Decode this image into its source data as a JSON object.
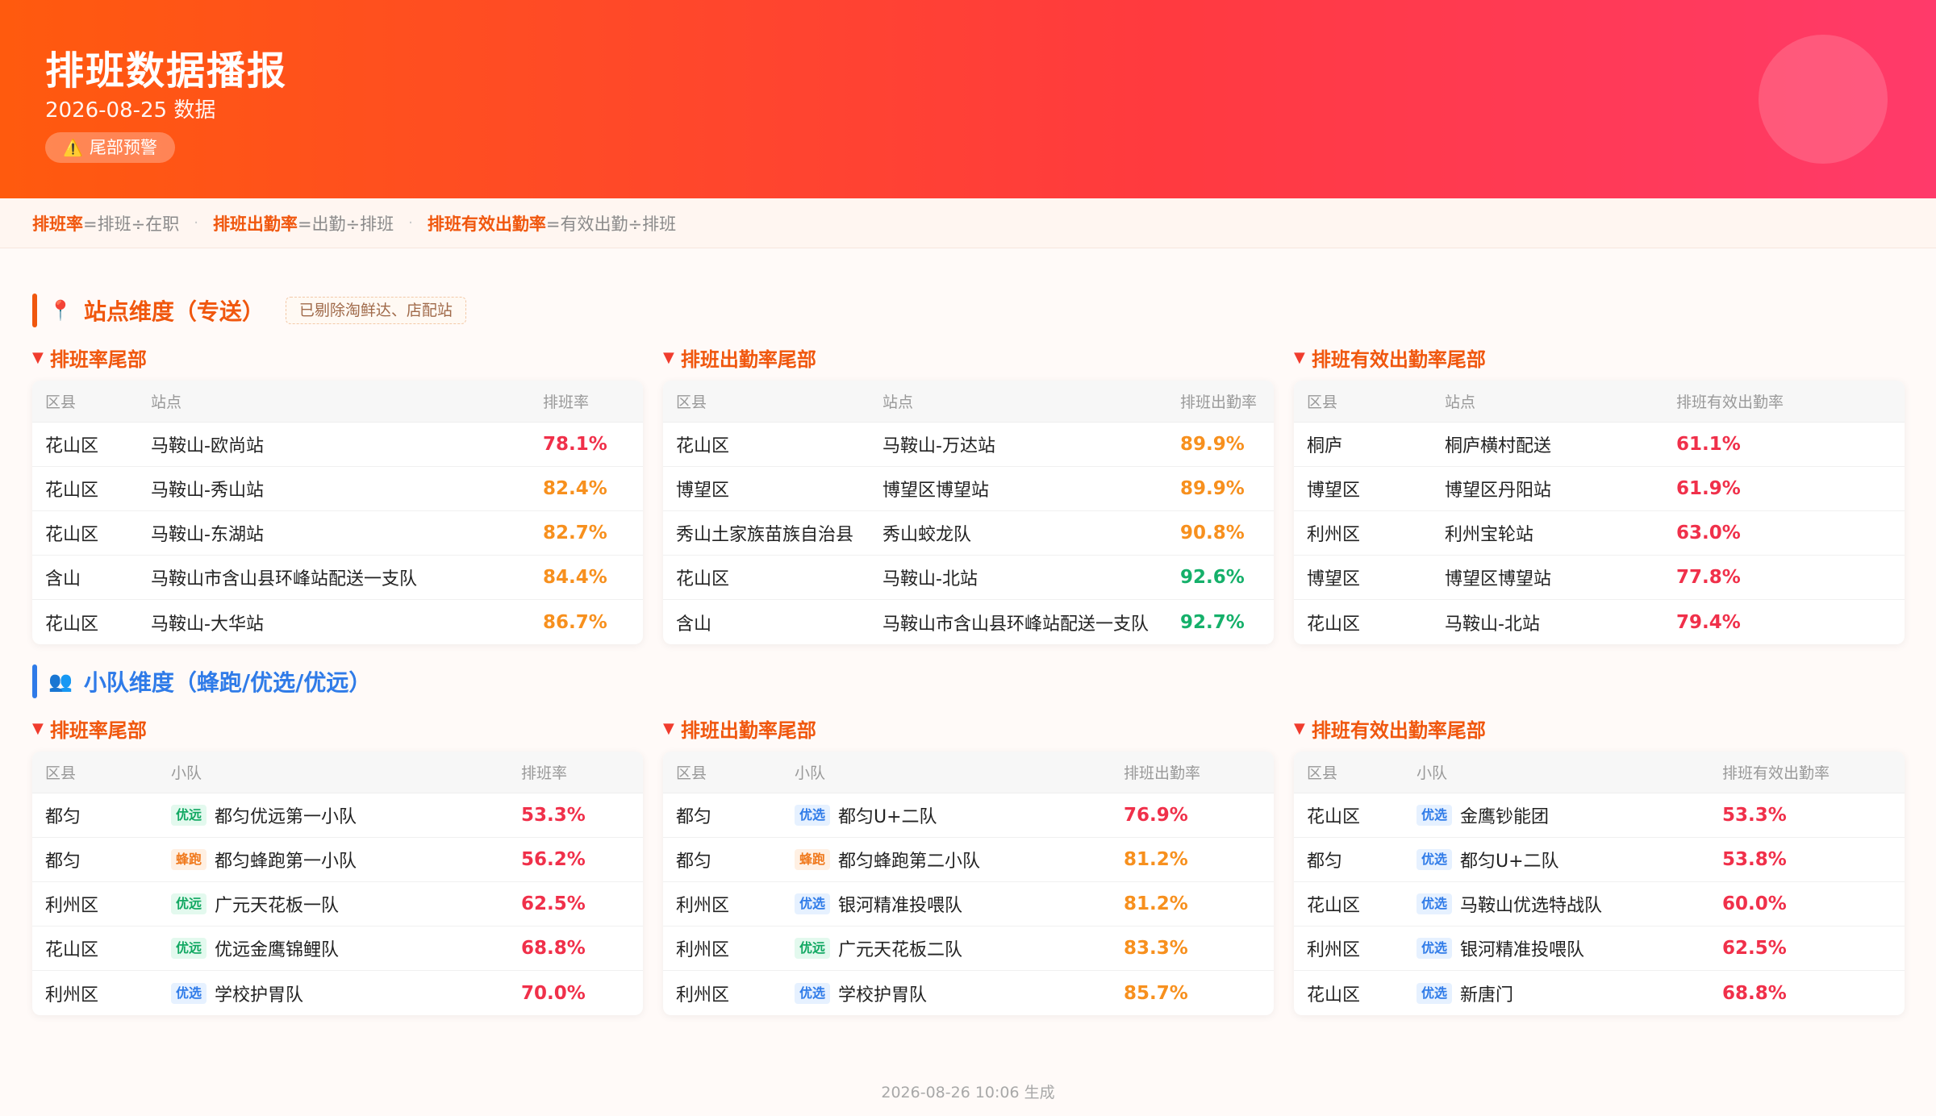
{
  "header": {
    "title": "排班数据播报",
    "subtitle": "2026-08-25 数据",
    "badge_icon": "⚠️",
    "badge_label": "尾部预警"
  },
  "formulas": [
    {
      "key": "排班率",
      "expr": "=排班÷在职"
    },
    {
      "key": "排班出勤率",
      "expr": "=出勤÷排班"
    },
    {
      "key": "排班有效出勤率",
      "expr": "=有效出勤÷排班"
    }
  ],
  "colors": {
    "accent": "#f0570e",
    "red": "#f0304a",
    "orange": "#f7901e",
    "green": "#15b06a",
    "blue": "#2f7be8"
  },
  "station_section": {
    "icon": "📍",
    "title": "站点维度（专送）",
    "tag": "已剔除淘鲜达、店配站",
    "panels": [
      {
        "title": "排班率尾部",
        "headers": [
          "区县",
          "站点",
          "排班率"
        ],
        "rows": [
          {
            "district": "花山区",
            "name": "马鞍山-欧尚站",
            "rate": "78.1%",
            "level": "red"
          },
          {
            "district": "花山区",
            "name": "马鞍山-秀山站",
            "rate": "82.4%",
            "level": "orange"
          },
          {
            "district": "花山区",
            "name": "马鞍山-东湖站",
            "rate": "82.7%",
            "level": "orange"
          },
          {
            "district": "含山",
            "name": "马鞍山市含山县环峰站配送一支队",
            "rate": "84.4%",
            "level": "orange"
          },
          {
            "district": "花山区",
            "name": "马鞍山-大华站",
            "rate": "86.7%",
            "level": "orange"
          }
        ]
      },
      {
        "title": "排班出勤率尾部",
        "headers": [
          "区县",
          "站点",
          "排班出勤率"
        ],
        "rows": [
          {
            "district": "花山区",
            "name": "马鞍山-万达站",
            "rate": "89.9%",
            "level": "orange"
          },
          {
            "district": "博望区",
            "name": "博望区博望站",
            "rate": "89.9%",
            "level": "orange"
          },
          {
            "district": "秀山土家族苗族自治县",
            "name": "秀山蛟龙队",
            "rate": "90.8%",
            "level": "orange"
          },
          {
            "district": "花山区",
            "name": "马鞍山-北站",
            "rate": "92.6%",
            "level": "green"
          },
          {
            "district": "含山",
            "name": "马鞍山市含山县环峰站配送一支队",
            "rate": "92.7%",
            "level": "green"
          }
        ]
      },
      {
        "title": "排班有效出勤率尾部",
        "headers": [
          "区县",
          "站点",
          "排班有效出勤率"
        ],
        "rows": [
          {
            "district": "桐庐",
            "name": "桐庐横村配送",
            "rate": "61.1%",
            "level": "red"
          },
          {
            "district": "博望区",
            "name": "博望区丹阳站",
            "rate": "61.9%",
            "level": "red"
          },
          {
            "district": "利州区",
            "name": "利州宝轮站",
            "rate": "63.0%",
            "level": "red"
          },
          {
            "district": "博望区",
            "name": "博望区博望站",
            "rate": "77.8%",
            "level": "red"
          },
          {
            "district": "花山区",
            "name": "马鞍山-北站",
            "rate": "79.4%",
            "level": "red"
          }
        ]
      }
    ]
  },
  "team_section": {
    "icon": "👥",
    "title": "小队维度（蜂跑/优选/优远）",
    "panels": [
      {
        "title": "排班率尾部",
        "headers": [
          "区县",
          "小队",
          "排班率"
        ],
        "rows": [
          {
            "district": "都匀",
            "tag": "优远",
            "tag_type": "youxuan",
            "name": "都匀优远第一小队",
            "rate": "53.3%",
            "level": "red"
          },
          {
            "district": "都匀",
            "tag": "蜂跑",
            "tag_type": "fengpao",
            "name": "都匀蜂跑第一小队",
            "rate": "56.2%",
            "level": "red"
          },
          {
            "district": "利州区",
            "tag": "优远",
            "tag_type": "youxuan",
            "name": "广元天花板一队",
            "rate": "62.5%",
            "level": "red"
          },
          {
            "district": "花山区",
            "tag": "优远",
            "tag_type": "youxuan",
            "name": "优远金鹰锦鲤队",
            "rate": "68.8%",
            "level": "red"
          },
          {
            "district": "利州区",
            "tag": "优选",
            "tag_type": "youyuan",
            "name": "学校护胃队",
            "rate": "70.0%",
            "level": "red"
          }
        ]
      },
      {
        "title": "排班出勤率尾部",
        "headers": [
          "区县",
          "小队",
          "排班出勤率"
        ],
        "rows": [
          {
            "district": "都匀",
            "tag": "优选",
            "tag_type": "youyuan",
            "name": "都匀U+二队",
            "rate": "76.9%",
            "level": "red"
          },
          {
            "district": "都匀",
            "tag": "蜂跑",
            "tag_type": "fengpao",
            "name": "都匀蜂跑第二小队",
            "rate": "81.2%",
            "level": "orange"
          },
          {
            "district": "利州区",
            "tag": "优选",
            "tag_type": "youyuan",
            "name": "银河精准投喂队",
            "rate": "81.2%",
            "level": "orange"
          },
          {
            "district": "利州区",
            "tag": "优远",
            "tag_type": "youxuan",
            "name": "广元天花板二队",
            "rate": "83.3%",
            "level": "orange"
          },
          {
            "district": "利州区",
            "tag": "优选",
            "tag_type": "youyuan",
            "name": "学校护胃队",
            "rate": "85.7%",
            "level": "orange"
          }
        ]
      },
      {
        "title": "排班有效出勤率尾部",
        "headers": [
          "区县",
          "小队",
          "排班有效出勤率"
        ],
        "rows": [
          {
            "district": "花山区",
            "tag": "优选",
            "tag_type": "youyuan",
            "name": "金鹰钞能团",
            "rate": "53.3%",
            "level": "red"
          },
          {
            "district": "都匀",
            "tag": "优选",
            "tag_type": "youyuan",
            "name": "都匀U+二队",
            "rate": "53.8%",
            "level": "red"
          },
          {
            "district": "花山区",
            "tag": "优选",
            "tag_type": "youyuan",
            "name": "马鞍山优选特战队",
            "rate": "60.0%",
            "level": "red"
          },
          {
            "district": "利州区",
            "tag": "优选",
            "tag_type": "youyuan",
            "name": "银河精准投喂队",
            "rate": "62.5%",
            "level": "red"
          },
          {
            "district": "花山区",
            "tag": "优选",
            "tag_type": "youyuan",
            "name": "新唐门",
            "rate": "68.8%",
            "level": "red"
          }
        ]
      }
    ]
  },
  "footer": "2026-08-26 10:06 生成"
}
